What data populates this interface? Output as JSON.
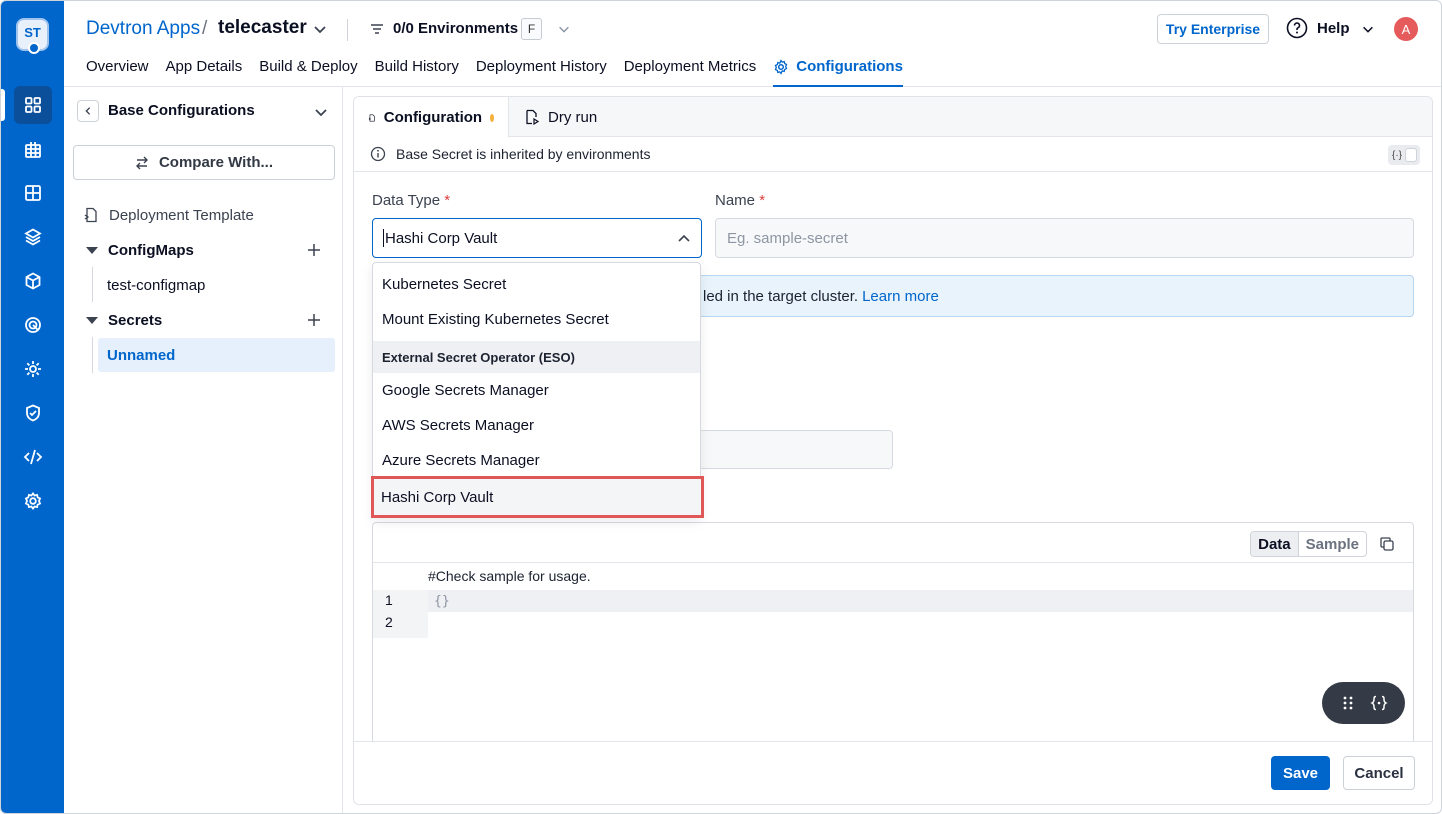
{
  "app": {
    "breadcrumb_root": "Devtron Apps",
    "breadcrumb_sep": "/",
    "app_name": "telecaster",
    "env_filter_label": "0/0 Environments",
    "env_filter_key": "F",
    "try_enterprise": "Try Enterprise",
    "help": "Help",
    "avatar_initial": "A",
    "logo_text": "ST"
  },
  "tabs": [
    "Overview",
    "App Details",
    "Build & Deploy",
    "Build History",
    "Deployment History",
    "Deployment Metrics",
    "Configurations"
  ],
  "sidebar": {
    "title": "Base Configurations",
    "compare_label": "Compare With...",
    "deployment_template": "Deployment Template",
    "configmaps_label": "ConfigMaps",
    "configmap_items": [
      "test-configmap"
    ],
    "secrets_label": "Secrets",
    "secret_items": [
      "Unnamed"
    ]
  },
  "panel": {
    "tab_config": "Configuration",
    "tab_dryrun": "Dry run",
    "info_text": "Base Secret is inherited by environments",
    "toggle_glyph": "{·}",
    "data_type_label": "Data Type",
    "name_label": "Name",
    "required_mark": "*",
    "data_type_value": "Hashi Corp Vault",
    "name_placeholder": "Eg. sample-secret",
    "notice_text": "led in the target cluster.",
    "notice_link": "Learn more",
    "editor_tab_data": "Data",
    "editor_tab_sample": "Sample",
    "editor_comment": "#Check sample for usage.",
    "line_numbers": [
      "1",
      "2"
    ],
    "line1_code": "{}",
    "save": "Save",
    "cancel": "Cancel"
  },
  "dropdown": {
    "options_top": [
      "Kubernetes Secret",
      "Mount Existing Kubernetes Secret"
    ],
    "group_label": "External Secret Operator (ESO)",
    "options_group": [
      "Google Secrets Manager",
      "AWS Secrets Manager",
      "Azure Secrets Manager",
      "Hashi Corp Vault"
    ],
    "selected": "Hashi Corp Vault"
  },
  "colors": {
    "brand": "#0066cc",
    "highlight_outline": "#e05757",
    "unsaved_dot": "#f4b23c"
  }
}
